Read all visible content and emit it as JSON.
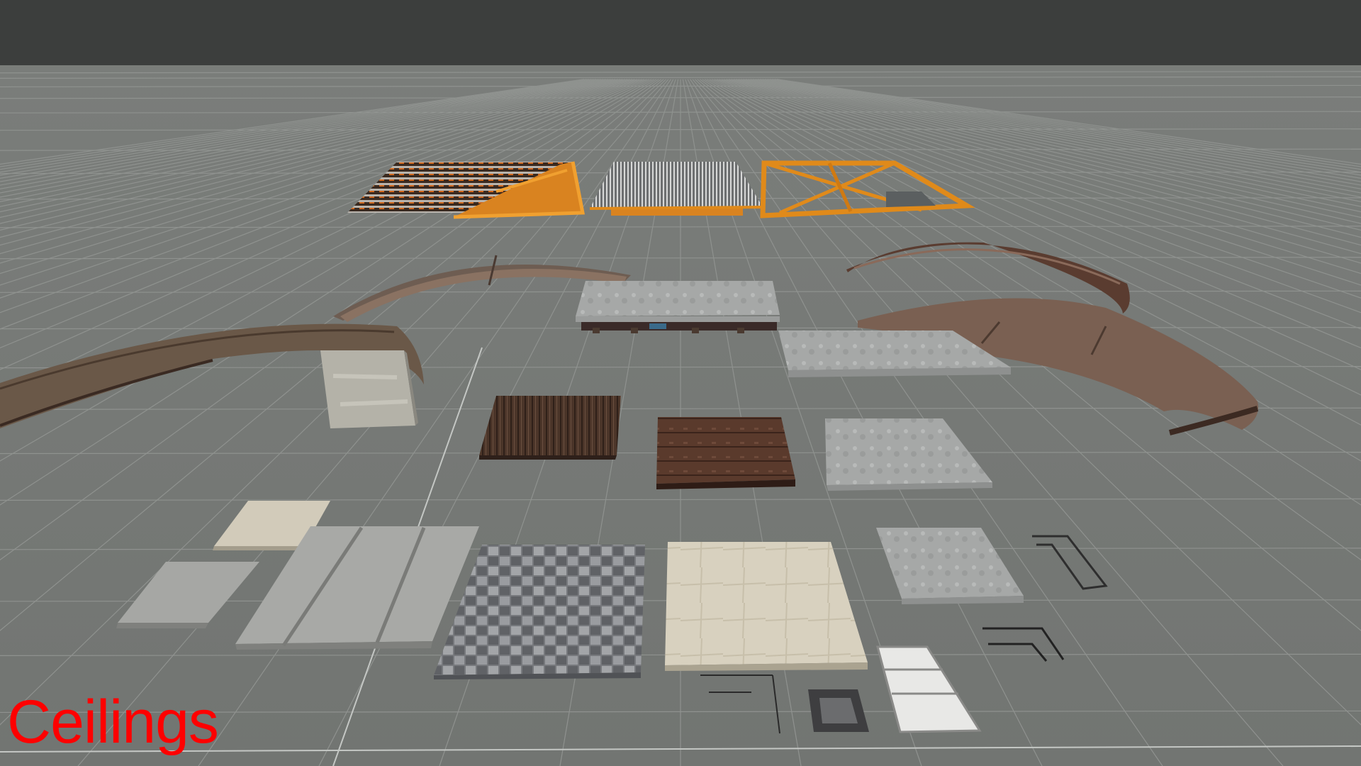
{
  "caption": {
    "text": "Ceilings",
    "color": "#ff0000"
  },
  "colors": {
    "sky": "#3c3e3d",
    "floor": "#777a77",
    "grid": "#8e918e",
    "grid_bright": "#c4c7c4",
    "orange_frame": "#e08a1a",
    "concrete": "#a9aaa8",
    "rusty_metal": "#6a5548",
    "cream_tile": "#d8d1bf",
    "dark_wood": "#4a3328"
  },
  "assets": [
    {
      "name": "orange-truss-with-pipes-ceiling"
    },
    {
      "name": "metal-grating-ceiling"
    },
    {
      "name": "orange-truss-frame-ceiling"
    },
    {
      "name": "curved-rusty-roof-left-back"
    },
    {
      "name": "curved-rusty-roof-right-back"
    },
    {
      "name": "curved-rusty-roof-left-front"
    },
    {
      "name": "curved-rusty-roof-right-front"
    },
    {
      "name": "concrete-slab-on-beams"
    },
    {
      "name": "concrete-slab-right"
    },
    {
      "name": "concrete-block-standing"
    },
    {
      "name": "dark-wood-planks-tile"
    },
    {
      "name": "rusty-metal-panel-tile"
    },
    {
      "name": "concrete-tile-square"
    },
    {
      "name": "cream-plaster-small-tile"
    },
    {
      "name": "concrete-panel-small"
    },
    {
      "name": "concrete-double-panel"
    },
    {
      "name": "granite-tiles-square"
    },
    {
      "name": "cream-plaster-large-tile"
    },
    {
      "name": "concrete-panel-right"
    },
    {
      "name": "metal-frame-piece"
    },
    {
      "name": "metal-bracket-piece"
    },
    {
      "name": "white-light-panel"
    },
    {
      "name": "dark-glass-tile"
    }
  ]
}
